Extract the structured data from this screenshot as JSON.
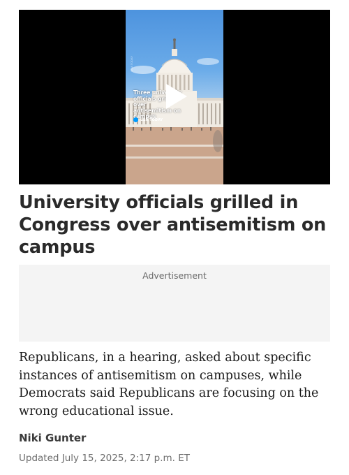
{
  "video": {
    "caption": "Three university officials grilled over antisemitism on campus",
    "source": "USA TODAY",
    "side_label": "USA TODAY",
    "play_icon": "play-icon"
  },
  "article": {
    "headline": "University officials grilled in Congress over antisemitism on campus",
    "summary": "Republicans, in a hearing, asked about specific instances of antisemitism on campuses, while Democrats said Republicans are focusing on the wrong educational issue.",
    "author": "Niki Gunter",
    "updated": "Updated July 15, 2025, 2:17 p.m. ET"
  },
  "ad": {
    "label": "Advertisement"
  },
  "colors": {
    "headline": "#2a2a2a",
    "ad_background": "#f4f4f4",
    "video_background": "#000000",
    "brand_dot": "#009bff"
  }
}
